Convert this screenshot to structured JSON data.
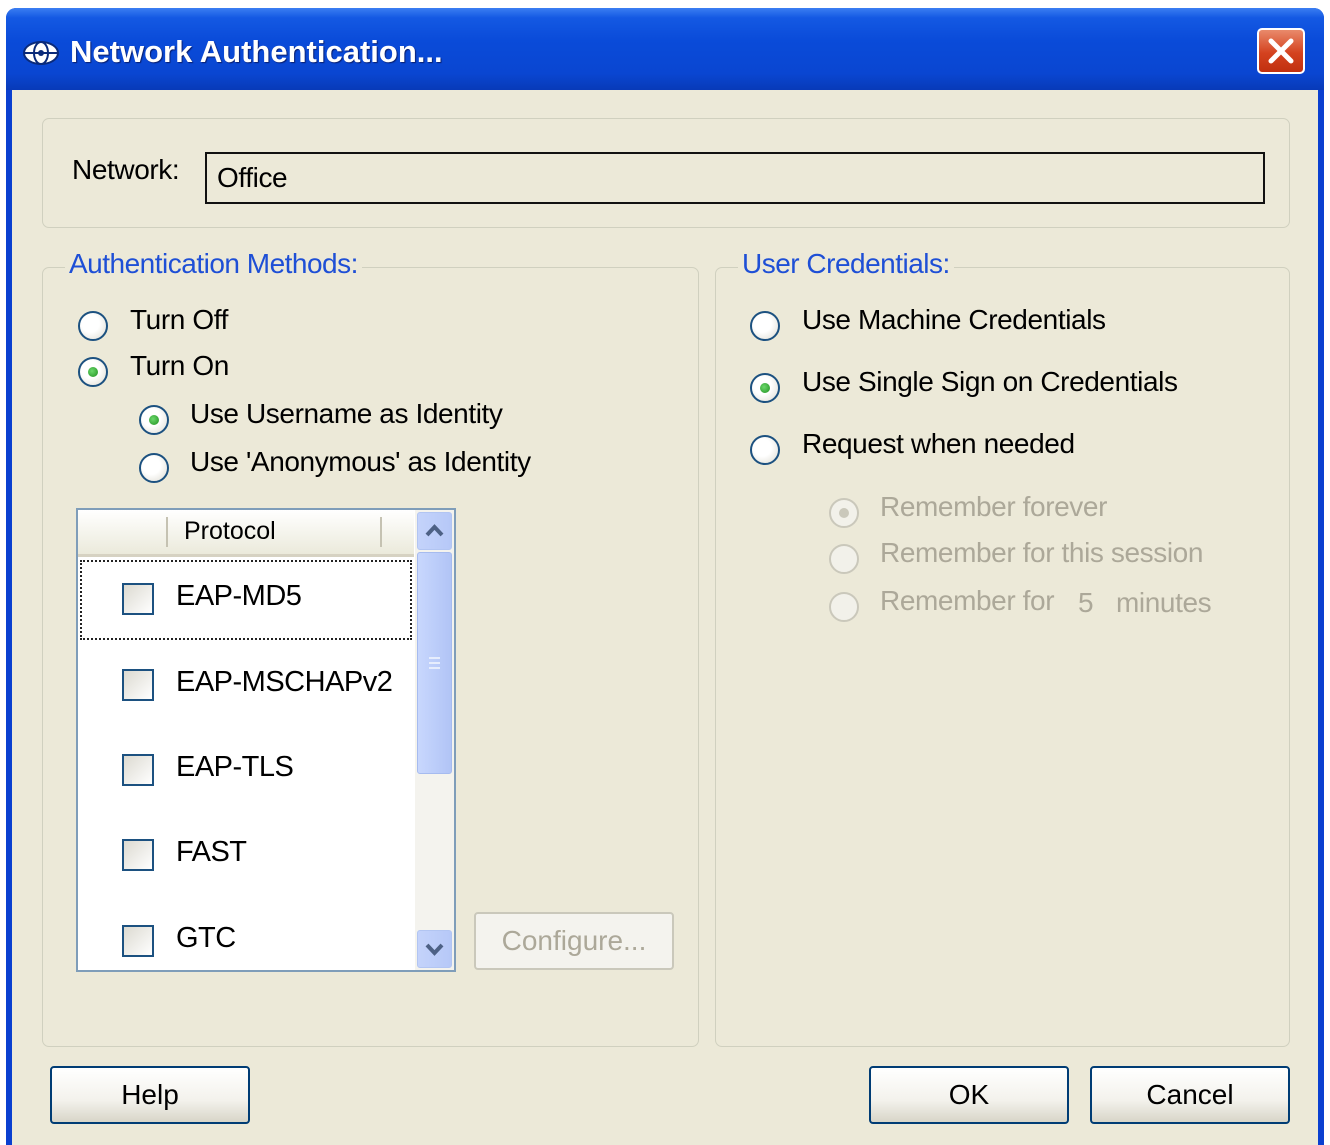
{
  "window": {
    "title": "Network Authentication...",
    "icon": "network-globe-icon",
    "close_icon": "close-icon"
  },
  "network": {
    "label": "Network:",
    "value": "Office"
  },
  "auth_methods": {
    "legend": "Authentication Methods:",
    "turn_off": "Turn Off",
    "turn_on": "Turn On",
    "use_username": "Use Username as Identity",
    "use_anonymous": "Use 'Anonymous' as Identity",
    "selected": "turn_on",
    "identity_selected": "use_username"
  },
  "protocol_list": {
    "header": "Protocol",
    "items": [
      {
        "label": "EAP-MD5",
        "checked": false
      },
      {
        "label": "EAP-MSCHAPv2",
        "checked": false
      },
      {
        "label": "EAP-TLS",
        "checked": false
      },
      {
        "label": "FAST",
        "checked": false
      },
      {
        "label": "GTC",
        "checked": false
      }
    ],
    "scroll_up_icon": "chevron-up-icon",
    "scroll_down_icon": "chevron-down-icon"
  },
  "configure_button": "Configure...",
  "user_credentials": {
    "legend": "User Credentials:",
    "machine": "Use Machine Credentials",
    "single_sign_on": "Use Single Sign on Credentials",
    "request": "Request when needed",
    "remember_forever": "Remember forever",
    "remember_session": "Remember for this session",
    "remember_for": "Remember for",
    "minutes_value": "5",
    "minutes_unit": "minutes",
    "selected": "single_sign_on",
    "remember_selected": "remember_forever"
  },
  "buttons": {
    "help": "Help",
    "ok": "OK",
    "cancel": "Cancel"
  },
  "colors": {
    "titlebar": "#0a46d1",
    "dialog_bg": "#ece9d8",
    "group_legend": "#1e4fd6",
    "disabled_text": "#aca899"
  }
}
